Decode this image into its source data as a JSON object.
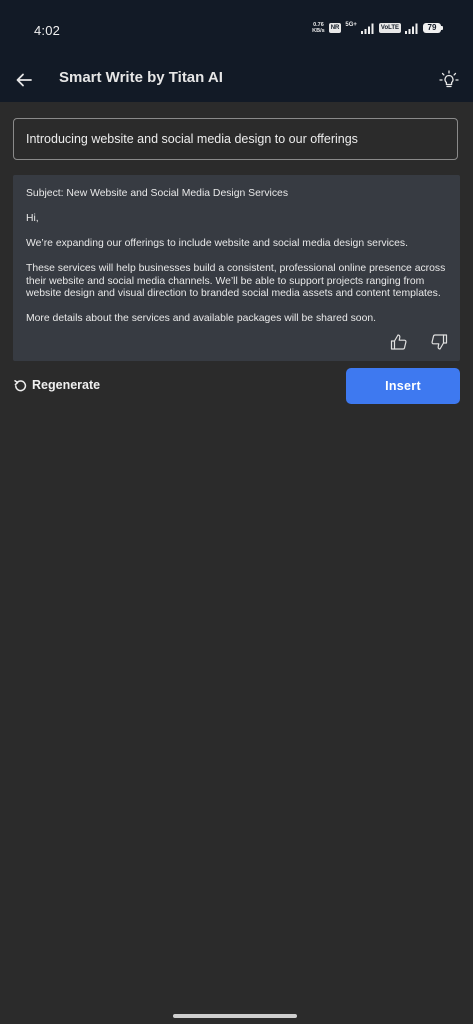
{
  "status_bar": {
    "time": "4:02",
    "speed_value": "0.76",
    "speed_unit": "KB/s",
    "badge_1": "NR",
    "signal_label": "5G+",
    "badge_2": "VoLTE",
    "battery": "79"
  },
  "app_bar": {
    "title": "Smart Write by Titan AI",
    "back_icon": "arrow-left-icon",
    "idea_icon": "lightbulb-icon"
  },
  "prompt": {
    "text": "Introducing website and social media design to our offerings"
  },
  "response": {
    "subject": "Subject: New Website and Social Media Design Services",
    "greeting": "Hi,",
    "paragraph_1": "We’re expanding our offerings to include website and social media design services.",
    "paragraph_2": "These services will help businesses build a consistent, professional online presence across their website and social media channels. We’ll be able to support projects ranging from website design and visual direction to branded social media assets and content templates.",
    "paragraph_3": "More details about the services and available packages will be shared soon.",
    "like_icon": "thumbs-up-icon",
    "dislike_icon": "thumbs-down-icon"
  },
  "actions": {
    "regenerate_label": "Regenerate",
    "insert_label": "Insert"
  },
  "colors": {
    "header_bg": "#121a26",
    "page_bg": "#2b2b2b",
    "card_bg": "#373b42",
    "accent": "#3e79f0"
  }
}
